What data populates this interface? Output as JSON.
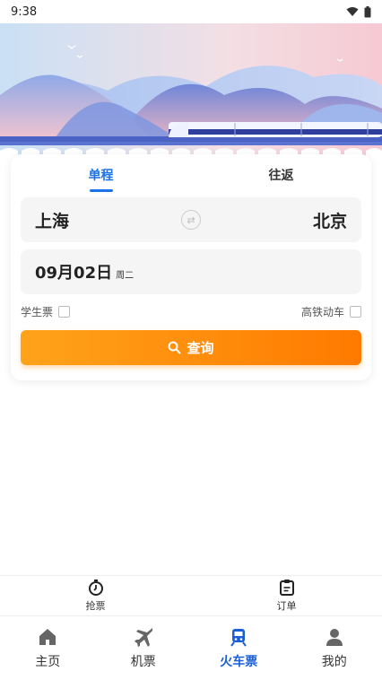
{
  "status": {
    "time": "9:38"
  },
  "tabs": [
    {
      "label": "单程",
      "active": true
    },
    {
      "label": "往返",
      "active": false
    }
  ],
  "route": {
    "from": "上海",
    "to": "北京"
  },
  "date": {
    "value": "09月02日",
    "weekday": "周二"
  },
  "options": {
    "student": "学生票",
    "highspeed": "高铁动车"
  },
  "query": {
    "label": "查询"
  },
  "sub_nav": [
    {
      "label": "抢票",
      "icon": "stopwatch-icon"
    },
    {
      "label": "订单",
      "icon": "clipboard-icon"
    }
  ],
  "bottom_nav": [
    {
      "label": "主页",
      "icon": "home-icon",
      "active": false
    },
    {
      "label": "机票",
      "icon": "airplane-icon",
      "active": false
    },
    {
      "label": "火车票",
      "icon": "train-icon",
      "active": true
    },
    {
      "label": "我的",
      "icon": "user-icon",
      "active": false
    }
  ],
  "colors": {
    "accent": "#1a73e8",
    "button_start": "#ffa31a",
    "button_end": "#ff7a00"
  }
}
